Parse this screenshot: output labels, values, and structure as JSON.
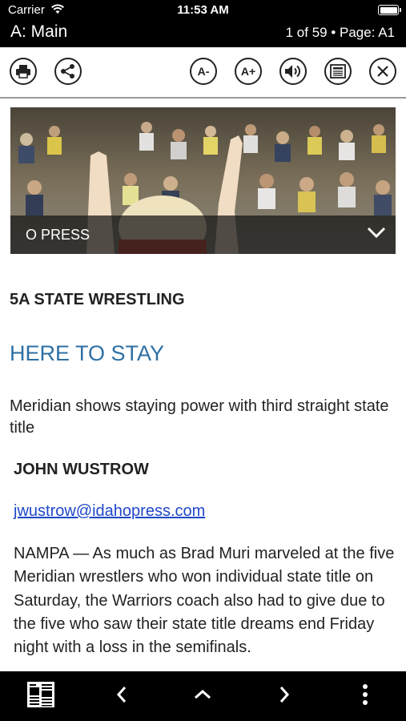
{
  "status": {
    "carrier": "Carrier",
    "time": "11:53 AM"
  },
  "header": {
    "title": "A: Main",
    "page_info": "1 of 59 • Page: A1"
  },
  "toolbar": {
    "print_icon": "print-icon",
    "share_icon": "share-icon",
    "font_decrease_label": "A-",
    "font_increase_label": "A+",
    "speaker_icon": "speaker-icon",
    "article_view_icon": "article-view-icon",
    "close_icon": "close-icon"
  },
  "hero": {
    "caption": "O PRESS"
  },
  "article": {
    "section": "5A STATE WRESTLING",
    "headline": "HERE TO STAY",
    "subhead": "Meridian shows staying power with third straight state title",
    "byline": "JOHN WUSTROW",
    "email": "jwustrow@idahopress.com",
    "body": "NAMPA — As much as Brad Muri marveled at the five Meridian wrestlers who won individual state title on Saturday, the Warriors coach also had to give due to the five who saw their state title dreams end Friday night with a loss in the semifinals."
  },
  "bottom_bar": {
    "pages_icon": "newspaper-pages-icon",
    "prev_icon": "chevron-left-icon",
    "up_icon": "chevron-up-icon",
    "next_icon": "chevron-right-icon",
    "more_icon": "more-vertical-icon"
  },
  "colors": {
    "headline": "#2e6fa3",
    "link": "#1f47c8",
    "bar": "#000000"
  }
}
